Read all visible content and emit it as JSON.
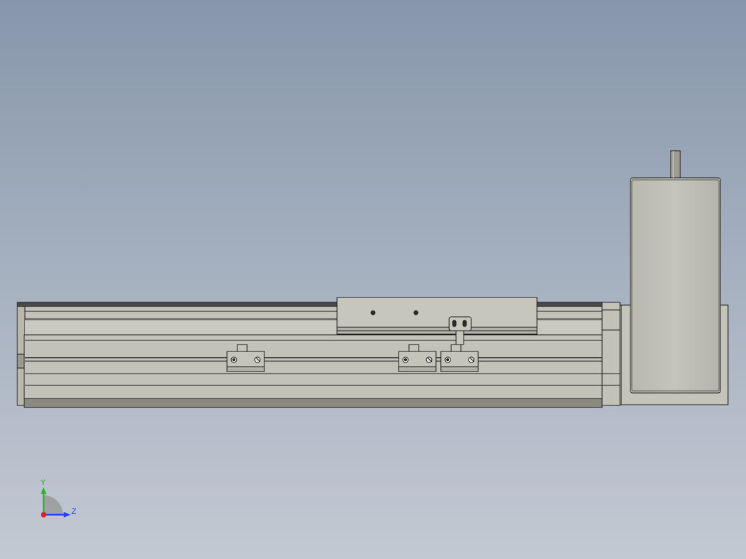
{
  "view": {
    "background_top": "#8796ab",
    "background_bottom": "#c3c9d3",
    "part_fill": "#c2c2b8",
    "part_dark": "#8a8a80",
    "edge_color": "#1e1e1e"
  },
  "triad": {
    "y_label": "Y",
    "z_label": "Z",
    "y_color": "#22bb22",
    "z_color": "#2244ee",
    "x_color": "#dd2222"
  }
}
